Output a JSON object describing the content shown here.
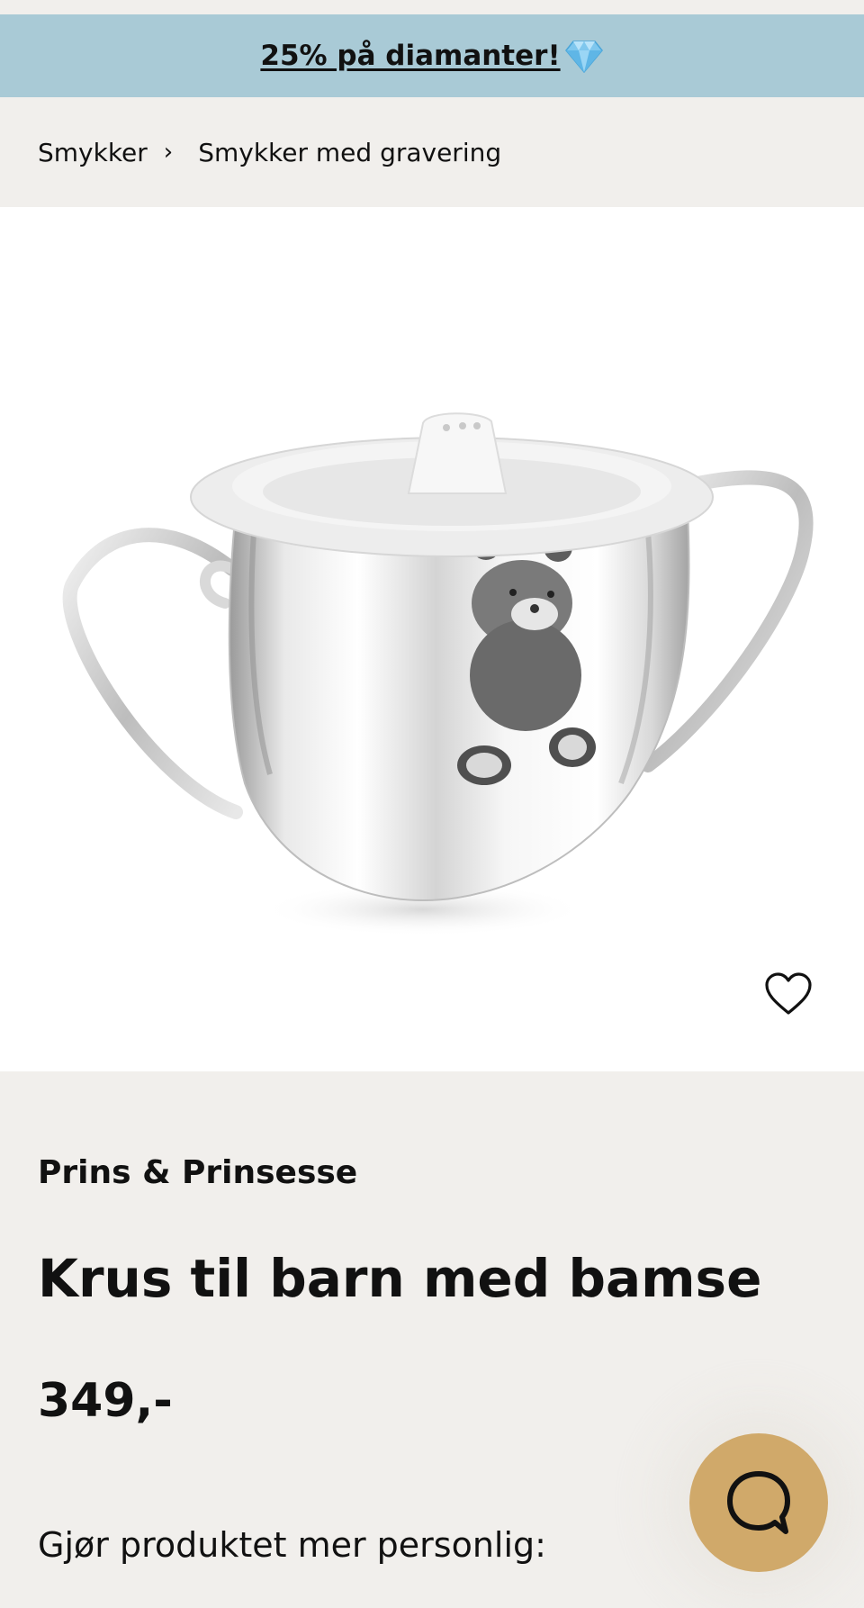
{
  "promo": {
    "text": "25% på diamanter!",
    "icon": "diamond-icon"
  },
  "breadcrumb": {
    "items": [
      "Smykker",
      "Smykker med gravering"
    ],
    "separator": "›"
  },
  "product": {
    "image_alt": "Krus til barn med bamse",
    "favorite_icon": "heart-outline-icon",
    "brand": "Prins & Prinsesse",
    "title": "Krus til barn med bamse",
    "price": "349,-",
    "personalize_heading": "Gjør produktet mer personlig:"
  },
  "chat": {
    "icon": "chat-bubble-icon"
  },
  "colors": {
    "promo_bg": "#a9cad6",
    "page_bg": "#f1efec",
    "chat_bg": "#d0a96a",
    "text": "#111111"
  }
}
